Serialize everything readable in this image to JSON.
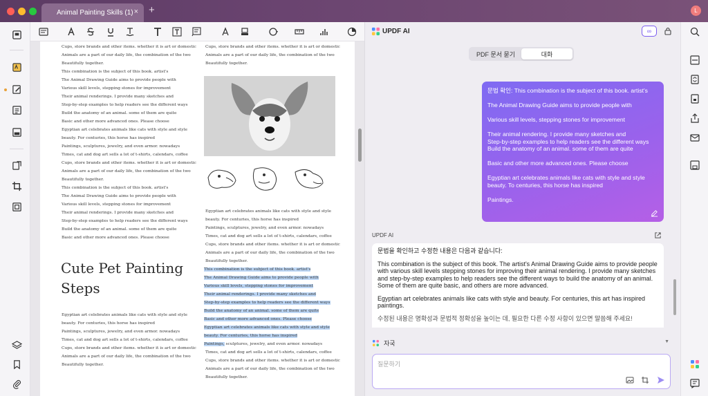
{
  "window": {
    "tab_title": "Animal Painting Skills (1)",
    "tab_close": "×",
    "new_tab": "+",
    "avatar_initial": "L",
    "traffic_colors": [
      "#ff5f57",
      "#febc2e",
      "#28c840"
    ]
  },
  "left_sidebar": {
    "icons": [
      "reader-icon",
      "comment-icon",
      "edit-pdf-icon",
      "organize-pages-icon",
      "form-icon",
      "convert-icon",
      "crop-icon",
      "ocr-icon",
      "layers-icon",
      "bookmark-icon",
      "attachment-icon"
    ]
  },
  "toolbar": {
    "icons": [
      "note-icon",
      "highlight-icon",
      "strikethrough-icon",
      "underline-icon",
      "squiggly-icon",
      "text-icon",
      "text-box-icon",
      "text-callout-icon",
      "pencil-icon",
      "eraser-icon",
      "shape-icon",
      "measure-icon",
      "stamp-icon",
      "signature-icon"
    ]
  },
  "document": {
    "left_column_top": [
      "Cups, store brands and other items. whether it is art or domestic",
      "Animals are a part of our daily life, the combination of the two",
      "Beautifully together.",
      "This combination is the subject of this book. artist's",
      "The Animal Drawing Guide aims to provide people with",
      "Various skill levels, stepping stones for improvement",
      "Their animal renderings. I provide many sketches and",
      "Step-by-step examples to help readers see the different ways",
      "Build the anatomy of an animal. some of them are quite",
      "Basic and other more advanced ones. Please choose",
      "Egyptian art celebrates animals like cats with style and style",
      "beauty. For centuries, this horse has inspired",
      "Paintings, sculptures, jewelry, and even armor. nowadays",
      "Times, cat and dog art sells a lot of t-shirts, calendars, coffee",
      "Cups, store brands and other items. whether it is art or domestic",
      "Animals are a part of our daily life, the combination of the two",
      "Beautifully together.",
      "This combination is the subject of this book. artist's",
      "The Animal Drawing Guide aims to provide people with",
      "Various skill levels, stepping stones for improvement",
      "Their animal renderings. I provide many sketches and",
      "Step-by-step examples to help readers see the different ways",
      "Build the anatomy of an animal. some of them are quite",
      "Basic and other more advanced ones. Please choose"
    ],
    "heading_line1": "Cute Pet Painting",
    "heading_line2": "Steps",
    "left_column_bottom": [
      "Egyptian art celebrates animals like cats with style and style",
      "beauty. For centuries, this horse has inspired",
      "Paintings, sculptures, jewelry, and even armor. nowadays",
      "Times, cat and dog art sells a lot of t-shirts, calendars, coffee",
      "Cups, store brands and other items. whether it is art or domestic",
      "Animals are a part of our daily life, the combination of the two",
      "Beautifully together."
    ],
    "right_column_top": [
      "Cups, store brands and other items. whether it is art or domestic",
      "Animals are a part of our daily life, the combination of the two",
      "Beautifully together."
    ],
    "right_column_mid": [
      "Egyptian art celebrates animals like cats with style and style",
      "beauty. For centuries, this horse has inspired",
      "Paintings, sculptures, jewelry, and even armor. nowadays",
      "Times, cat and dog art sells a lot of t-shirts, calendars, coffee",
      "Cups, store brands and other items. whether it is art or domestic",
      "Animals are a part of our daily life, the combination of the two",
      "Beautifully together."
    ],
    "right_column_highlighted": [
      "This combination is the subject of this book. artist's",
      "The Animal Drawing Guide aims to provide people with",
      "Various skill levels, stepping stones for improvement",
      "Their animal renderings. I provide many sketches and",
      "Step-by-step examples to help readers see the different ways",
      "Build the anatomy of an animal. some of them are quite",
      "Basic and other more advanced ones. Please choose",
      "Egyptian art celebrates animals like cats with style and style",
      "beauty. For centuries, this horse has inspired"
    ],
    "right_column_partial_hl": "Paintings,",
    "right_column_partial_rest": " sculptures, jewelry, and even armor. nowadays",
    "right_column_bottom": [
      "Times, cat and dog art sells a lot of t-shirts, calendars, coffee",
      "Cups, store brands and other items. whether it is art or domestic",
      "Animals are a part of our daily life, the combination of the two",
      "Beautifully together."
    ],
    "highlight_color": "#bcd6f5"
  },
  "ai_panel": {
    "title": "UPDF AI",
    "header_button": "∞",
    "tabs": [
      {
        "label": "PDF 문서 묻기",
        "active": false
      },
      {
        "label": "대화",
        "active": true
      }
    ],
    "user_message": {
      "lines": [
        "문법 확인: This combination is the subject of this book. artist's",
        "The Animal Drawing Guide aims to provide people with",
        "Various skill levels, stepping stones for improvement",
        "Their animal rendering. I provide many sketches and\nStep-by-step examples to help readers see the different ways\nBuild the anatomy of an animal. some of them are quite",
        "Basic and other more advanced ones. Please choose",
        "Egyptian art celebrates animals like cats with style and style\nbeauty. To centuries, this horse has inspired",
        "Paintings."
      ]
    },
    "response_label": "UPDF AI",
    "response": {
      "intro": "문법을 확인하고 수정한 내용은 다음과 같습니다:",
      "p1": "This combination is the subject of this book. The artist's Animal Drawing Guide aims to provide people with various skill levels stepping stones for improving their animal rendering. I provide many sketches and step-by-step examples to help readers see the different ways to build the anatomy of an animal. Some of them are quite basic, and others are more advanced.",
      "p2": "Egyptian art celebrates animals like cats with style and beauty. For centuries, this art has inspired paintings.",
      "p3": "수정된 내용은 명확성과 문법적 정확성을 높이는 데, 필요한 다른 수정 사항이 있으면 말씀해 주세요!"
    },
    "prompt_select": "자국",
    "input_placeholder": "질문하기",
    "accent_color": "#7b5cf0"
  },
  "right_sidebar": {
    "icons": [
      "search-icon",
      "ocr-icon",
      "convert-icon",
      "protect-icon",
      "share-icon",
      "email-icon",
      "save-icon",
      "updf-ai-icon",
      "comment-list-icon"
    ]
  }
}
